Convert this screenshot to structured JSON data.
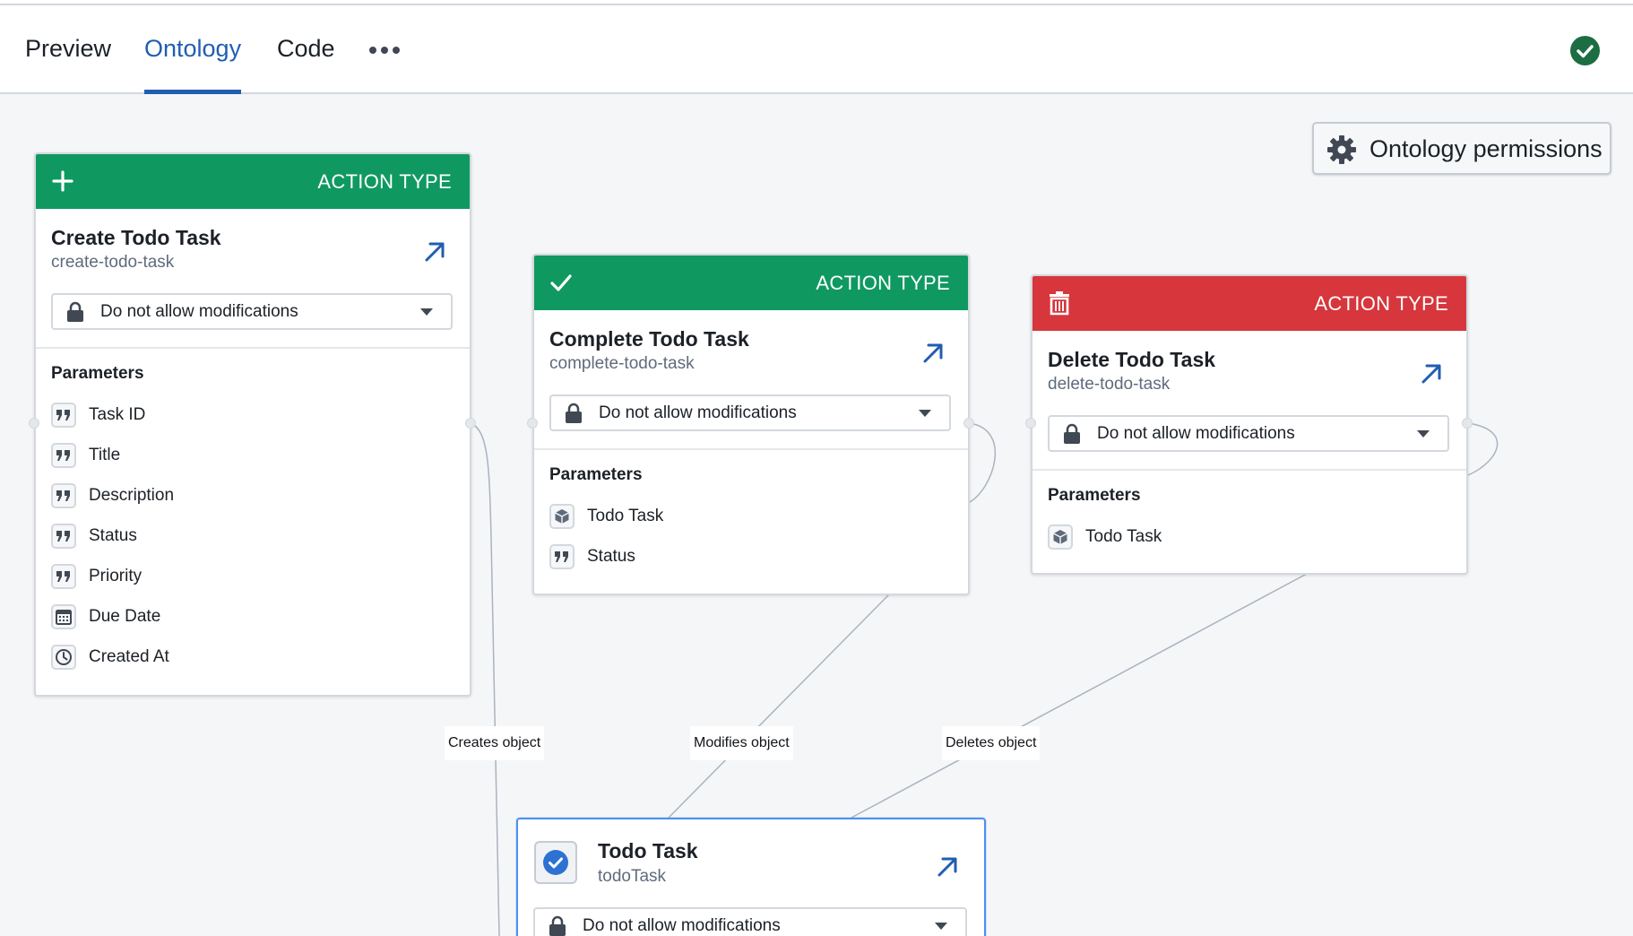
{
  "tabs": {
    "preview": "Preview",
    "ontology": "Ontology",
    "code": "Code",
    "more_icon": "more-horizontal-icon",
    "status_icon": "check-circle-icon",
    "active": "Ontology"
  },
  "permissions_button": {
    "label": "Ontology permissions",
    "icon": "gear-icon"
  },
  "cards": [
    {
      "kind": "ACTION TYPE",
      "head_color": "#0f9960",
      "head_icon": "plus-icon",
      "title": "Create Todo Task",
      "api_name": "create-todo-task",
      "modification": "Do not allow modifications",
      "params_title": "Parameters",
      "params": [
        {
          "label": "Task ID",
          "icon": "quote-icon"
        },
        {
          "label": "Title",
          "icon": "quote-icon"
        },
        {
          "label": "Description",
          "icon": "quote-icon"
        },
        {
          "label": "Status",
          "icon": "quote-icon"
        },
        {
          "label": "Priority",
          "icon": "quote-icon"
        },
        {
          "label": "Due Date",
          "icon": "calendar-icon"
        },
        {
          "label": "Created At",
          "icon": "clock-icon"
        }
      ]
    },
    {
      "kind": "ACTION TYPE",
      "head_color": "#0f9960",
      "head_icon": "check-icon",
      "title": "Complete Todo Task",
      "api_name": "complete-todo-task",
      "modification": "Do not allow modifications",
      "params_title": "Parameters",
      "params": [
        {
          "label": "Todo Task",
          "icon": "cube-icon"
        },
        {
          "label": "Status",
          "icon": "quote-icon"
        }
      ]
    },
    {
      "kind": "ACTION TYPE",
      "head_color": "#d6363c",
      "head_icon": "trash-icon",
      "title": "Delete Todo Task",
      "api_name": "delete-todo-task",
      "modification": "Do not allow modifications",
      "params_title": "Parameters",
      "params": [
        {
          "label": "Todo Task",
          "icon": "cube-icon"
        }
      ]
    }
  ],
  "edge_labels": {
    "creates": "Creates object",
    "modifies": "Modifies object",
    "deletes": "Deletes object"
  },
  "object_type": {
    "title": "Todo Task",
    "api_name": "todoTask",
    "icon": "check-circle-icon",
    "modification": "Do not allow modifications"
  },
  "colors": {
    "accent": "#215db0",
    "action_green": "#0f9960",
    "action_red": "#d6363c",
    "object_border": "#4c90f0",
    "status_ok": "#1c6e42"
  }
}
